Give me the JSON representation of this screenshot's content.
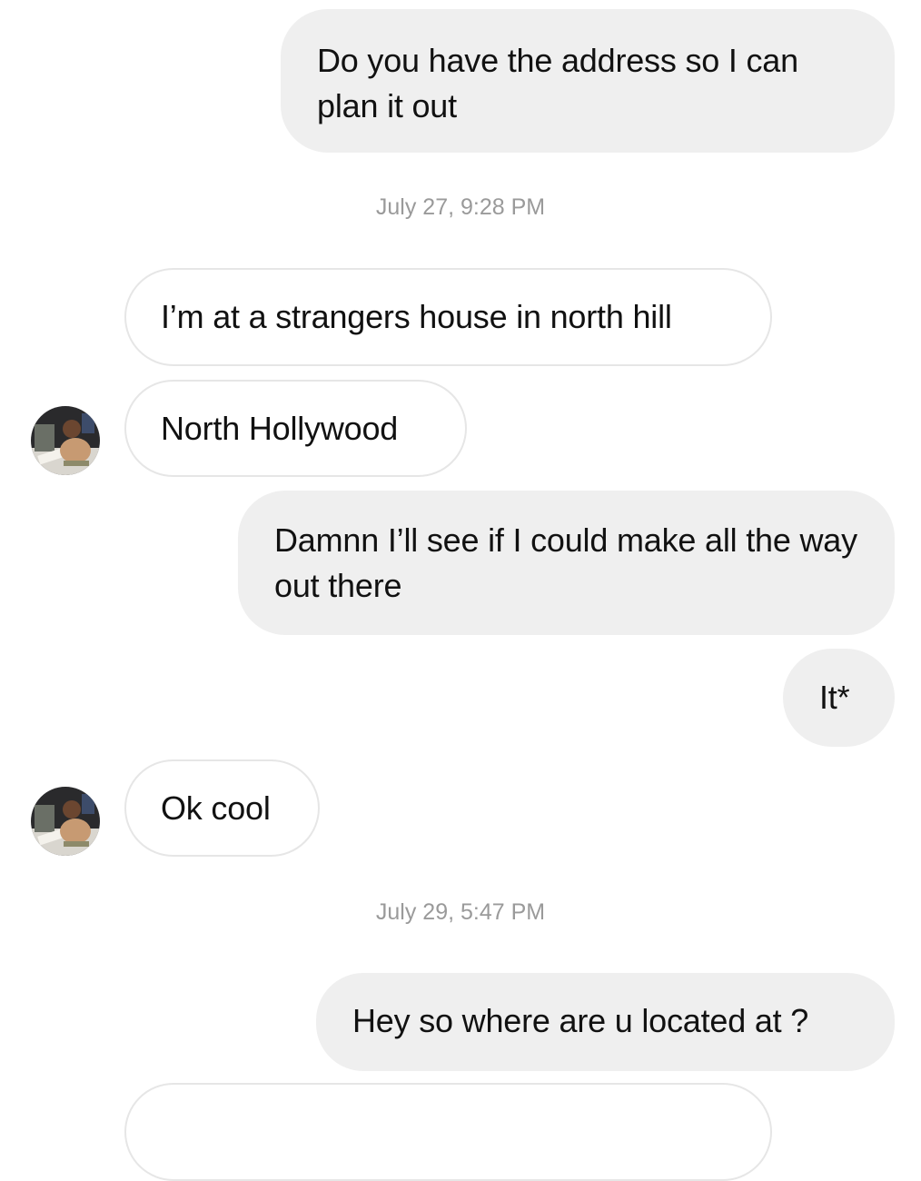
{
  "conversation": {
    "messages": [
      {
        "from": "me",
        "text": "Do you have the address so I can plan it out"
      },
      {
        "timestamp": "July 27, 9:28 PM"
      },
      {
        "from": "them",
        "text": "I’m at a strangers house in north hill"
      },
      {
        "from": "them",
        "text": "North Hollywood",
        "avatar": "profile-photo"
      },
      {
        "from": "me",
        "text": "Damnn I’ll see if I could make all the way out there"
      },
      {
        "from": "me",
        "text": "It*"
      },
      {
        "from": "them",
        "text": "Ok cool",
        "avatar": "profile-photo"
      },
      {
        "timestamp": "July 29, 5:47 PM"
      },
      {
        "from": "me",
        "text": "Hey so where are u located at ?"
      }
    ]
  },
  "colors": {
    "sent_bubble": "#efefef",
    "received_bubble_border": "#e6e6e6",
    "timestamp_text": "#9a9a9a",
    "message_text": "#111111"
  }
}
